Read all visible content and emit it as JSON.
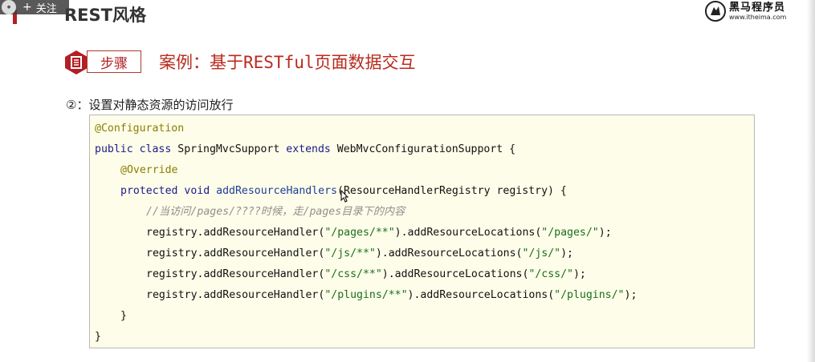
{
  "overlay": {
    "follow_plus": "+",
    "follow_label": "关注"
  },
  "header": {
    "title": "REST风格"
  },
  "logo": {
    "name": "黑马程序员",
    "url": "www.itheima.com"
  },
  "step": {
    "label": "步骤",
    "case_title": "案例：基于RESTful页面数据交互"
  },
  "subtitle": "②：设置对静态资源的访问放行",
  "code": {
    "annotation_configuration": "@Configuration",
    "class_kw_public": "public",
    "class_kw_class": "class",
    "class_name": "SpringMvcSupport",
    "class_kw_extends": "extends",
    "class_parent": "WebMvcConfigurationSupport {",
    "annotation_override": "@Override",
    "method_kw_protected": "protected",
    "method_kw_void": "void",
    "method_name": "addResourceHandlers",
    "method_params": "(ResourceHandlerRegistry registry) {",
    "comment": "//当访问/pages/????时候，走/pages目录下的内容",
    "registry_lines": [
      {
        "prefix": "registry.addResourceHandler(",
        "pattern": "\"/pages/**\"",
        "middle": ").addResourceLocations(",
        "location": "\"/pages/\"",
        "suffix": ");"
      },
      {
        "prefix": "registry.addResourceHandler(",
        "pattern": "\"/js/**\"",
        "middle": ").addResourceLocations(",
        "location": "\"/js/\"",
        "suffix": ");"
      },
      {
        "prefix": "registry.addResourceHandler(",
        "pattern": "\"/css/**\"",
        "middle": ").addResourceLocations(",
        "location": "\"/css/\"",
        "suffix": ");"
      },
      {
        "prefix": "registry.addResourceHandler(",
        "pattern": "\"/plugins/**\"",
        "middle": ").addResourceLocations(",
        "location": "\"/plugins/\"",
        "suffix": ");"
      }
    ],
    "close_method": "}",
    "close_class": "}"
  },
  "colors": {
    "accent_red": "#b21f24",
    "code_bg": "#fdfde9"
  }
}
